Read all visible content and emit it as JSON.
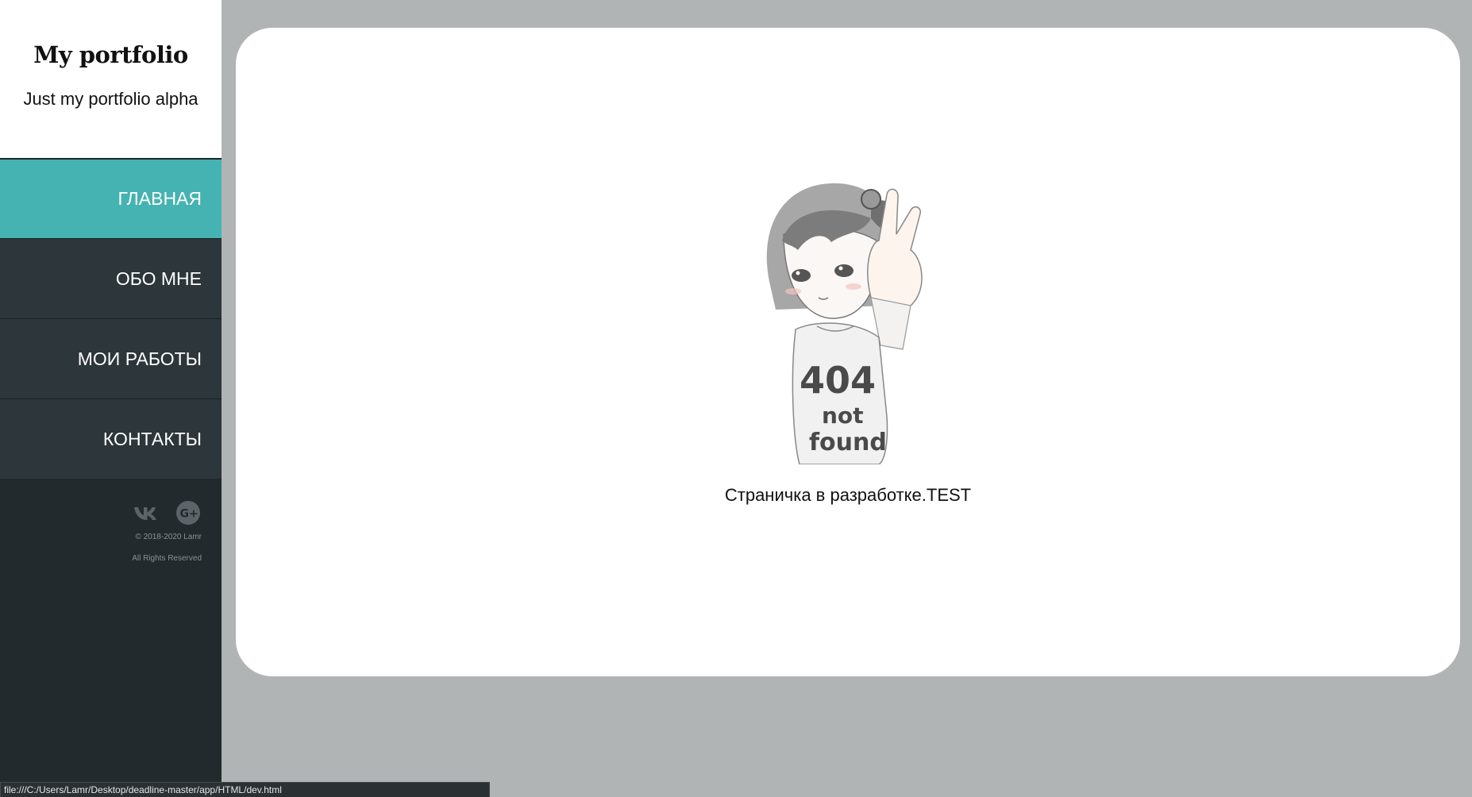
{
  "sidebar": {
    "brand_title": "My portfolio",
    "brand_subtitle": "Just my portfolio alpha",
    "nav": {
      "home": "ГЛАВНАЯ",
      "about": "ОБО МНЕ",
      "works": "МОИ РАБОТЫ",
      "contacts": "КОНТАКТЫ"
    },
    "active_item": "home",
    "socials": [
      "vk-icon",
      "google-plus-icon"
    ],
    "copyright": "© 2018-2020 Lamr",
    "rights": "All Rights Reserved"
  },
  "main": {
    "illustration_text": {
      "line1": "404",
      "line2": "not",
      "line3": "found"
    },
    "caption": "Страничка в разработке.TEST"
  },
  "statusbar": {
    "url": "file:///C:/Users/Lamr/Desktop/deadline-master/app/HTML/dev.html"
  },
  "colors": {
    "accent": "#45b3b1",
    "sidebar_bg": "#222a2e",
    "nav_bg": "#2d363a",
    "page_bg": "#b1b4b5"
  }
}
